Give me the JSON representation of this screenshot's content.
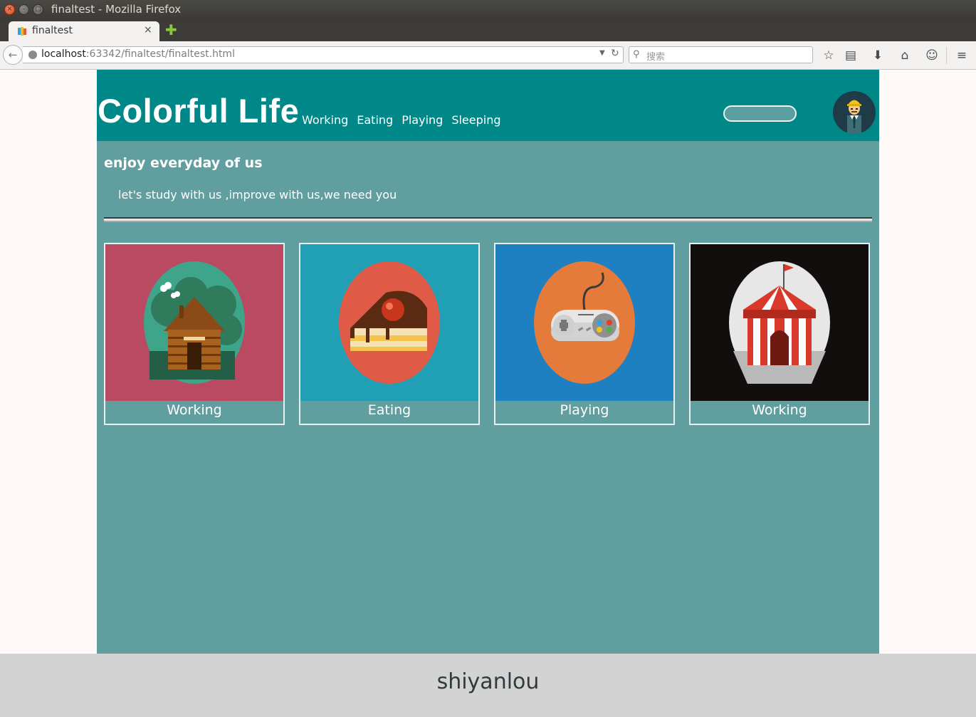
{
  "window": {
    "title": "finaltest - Mozilla Firefox"
  },
  "tab": {
    "label": "finaltest",
    "close_glyph": "×",
    "new_tab_glyph": "✚"
  },
  "navbar": {
    "url_host": "localhost",
    "url_rest": ":63342/finaltest/finaltest.html",
    "search_placeholder": "搜索",
    "icons": [
      "back-arrow-icon",
      "bookmark-star-icon",
      "reading-list-icon",
      "download-icon",
      "home-icon",
      "chat-icon",
      "menu-icon"
    ]
  },
  "site": {
    "title": "Colorful Life",
    "nav": [
      "Working",
      "Eating",
      "Playing",
      "Sleeping"
    ],
    "tagline": "enjoy everyday of us",
    "subline": "let's study with us ,improve with us,we need you",
    "cards": [
      {
        "caption": "Working",
        "bg": "#b94a62",
        "circle": "#3fa58a",
        "icon": "log-cabin-icon"
      },
      {
        "caption": "Eating",
        "bg": "#21a0b5",
        "circle": "#e05a48",
        "icon": "cake-slice-icon"
      },
      {
        "caption": "Playing",
        "bg": "#1e7fc1",
        "circle": "#e57b3a",
        "icon": "game-controller-icon"
      },
      {
        "caption": "Working",
        "bg": "#120e0d",
        "circle": "#e7e7e7",
        "icon": "circus-tent-icon"
      }
    ],
    "footer": "shiyanlou"
  },
  "colors": {
    "header": "#008888",
    "page": "#619e9f",
    "footer": "#d3d3d3"
  }
}
